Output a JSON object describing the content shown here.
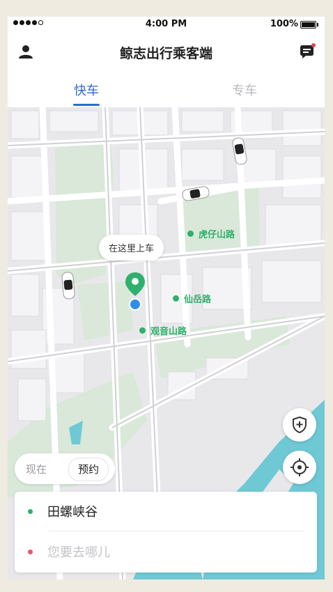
{
  "status_bar": {
    "time": "4:00 PM",
    "battery": "100%"
  },
  "header": {
    "title": "鲸志出行乘客端"
  },
  "tabs": [
    {
      "label": "快车",
      "active": true
    },
    {
      "label": "专车",
      "active": false
    }
  ],
  "map": {
    "pickup_bubble": "在这里上车",
    "streets": [
      "虎仔山路",
      "仙岳路",
      "观音山路"
    ]
  },
  "time_toggle": {
    "now": "现在",
    "reserve": "预约"
  },
  "address": {
    "from": "田螺峡谷",
    "to_placeholder": "您要去哪儿"
  },
  "colors": {
    "accent": "#2f6cc8",
    "green": "#2fb06c",
    "destination": "#e25a6a",
    "water": "#6fc9d5"
  }
}
